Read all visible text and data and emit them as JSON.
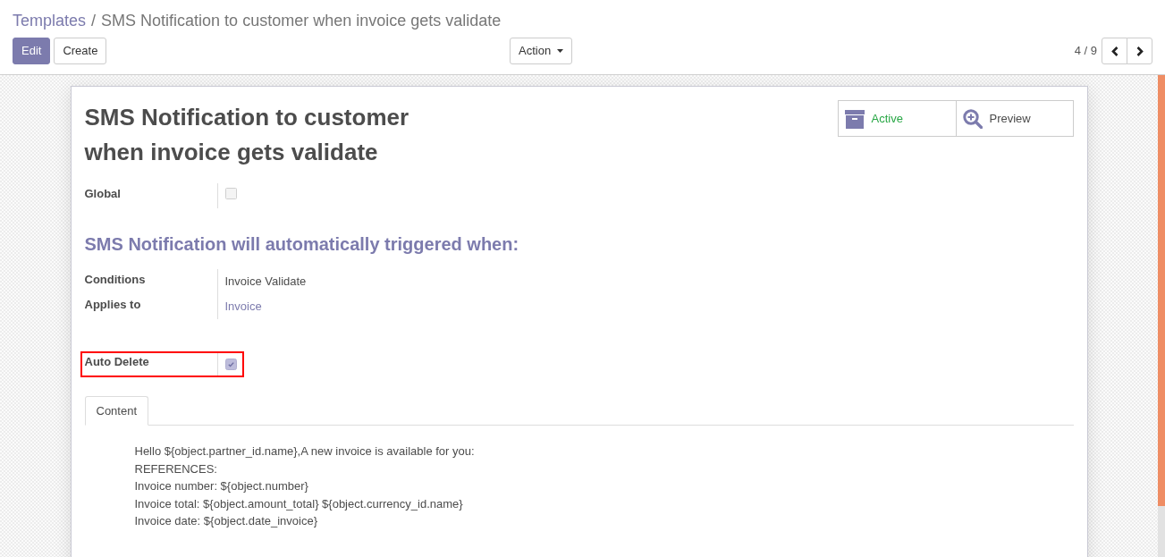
{
  "breadcrumb": {
    "items": [
      {
        "label": "Templates",
        "kind": "link"
      },
      {
        "label": "SMS Notification to customer when invoice gets validate",
        "kind": "current"
      }
    ],
    "separator": "/"
  },
  "toolbar": {
    "buttons": [
      {
        "label": "Edit",
        "kind": "primary"
      },
      {
        "label": "Create",
        "kind": "secondary"
      }
    ],
    "action_menu": {
      "label": "Action"
    }
  },
  "pager": {
    "counter": "4 / 9"
  },
  "form": {
    "title": "SMS Notification to customer when invoice gets validate",
    "smart_buttons": [
      {
        "label": "Active",
        "kind": "archive",
        "active": true
      },
      {
        "label": "Preview",
        "kind": "preview"
      }
    ],
    "fields": [
      {
        "label": "Global",
        "kind": "checkbox",
        "checked": false
      }
    ],
    "section_title": "SMS Notification will automatically triggered when:",
    "trigger_fields": [
      {
        "label": "Conditions",
        "kind": "text",
        "value": "Invoice Validate"
      },
      {
        "label": "Applies to",
        "kind": "link",
        "value": "Invoice"
      }
    ],
    "option_fields": [
      {
        "label": "Auto Delete",
        "kind": "checkbox",
        "checked": true,
        "highlighted": true
      }
    ],
    "tabs": [
      {
        "label": "Content",
        "selected": true
      }
    ],
    "content_lines": [
      "Hello ${object.partner_id.name},A new invoice is available for you:",
      "REFERENCES:",
      "Invoice number: ${object.number}",
      "Invoice total: ${object.amount_total} ${object.currency_id.name}",
      "Invoice date: ${object.date_invoice}"
    ]
  }
}
